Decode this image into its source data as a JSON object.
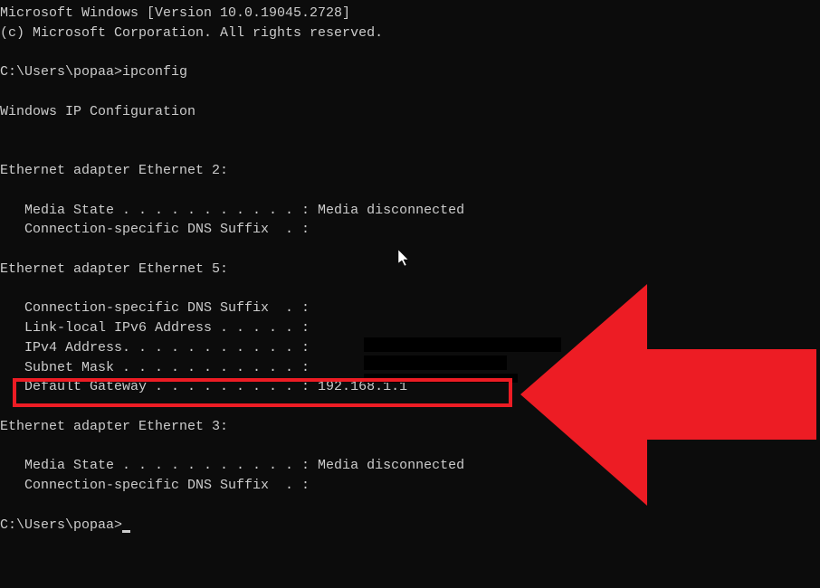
{
  "header": {
    "line1": "Microsoft Windows [Version 10.0.19045.2728]",
    "line2": "(c) Microsoft Corporation. All rights reserved.",
    "blank1": ""
  },
  "prompt": {
    "path": "C:\\Users\\popaa>",
    "command": "ipconfig"
  },
  "output": {
    "blank1": "",
    "title": "Windows IP Configuration",
    "blank2": "",
    "blank3": "",
    "adapter2": {
      "header": "Ethernet adapter Ethernet 2:",
      "blank1": "",
      "media_state": "   Media State . . . . . . . . . . . : Media disconnected",
      "dns_suffix": "   Connection-specific DNS Suffix  . :"
    },
    "blank4": "",
    "adapter5": {
      "header": "Ethernet adapter Ethernet 5:",
      "blank1": "",
      "dns_suffix": "   Connection-specific DNS Suffix  . :",
      "link_local": "   Link-local IPv6 Address . . . . . :",
      "ipv4": "   IPv4 Address. . . . . . . . . . . :",
      "subnet": "   Subnet Mask . . . . . . . . . . . :",
      "gateway": "   Default Gateway . . . . . . . . . : 192.168.1.1"
    },
    "blank5": "",
    "adapter3": {
      "header": "Ethernet adapter Ethernet 3:",
      "blank1": "",
      "media_state": "   Media State . . . . . . . . . . . : Media disconnected",
      "dns_suffix": "   Connection-specific DNS Suffix  . :"
    },
    "blank6": ""
  },
  "prompt2": {
    "path": "C:\\Users\\popaa>"
  },
  "annotations": {
    "highlight_color": "#ed1c24",
    "arrow_color": "#ed1c24"
  }
}
